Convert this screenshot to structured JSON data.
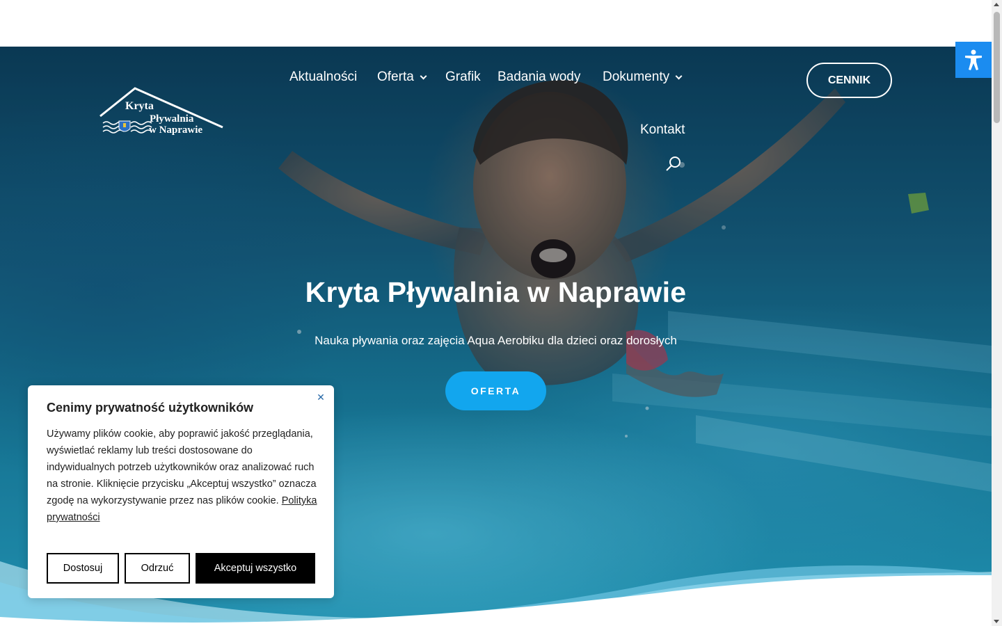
{
  "logo": {
    "line1": "Kryta",
    "line2": "Pływalnia",
    "line3": "w Naprawie"
  },
  "nav": {
    "items": [
      {
        "label": "Aktualności",
        "has_dropdown": false
      },
      {
        "label": "Oferta",
        "has_dropdown": true
      },
      {
        "label": "Grafik",
        "has_dropdown": false
      },
      {
        "label": "Badania wody",
        "has_dropdown": false
      },
      {
        "label": "Dokumenty",
        "has_dropdown": true
      },
      {
        "label": "Kontakt",
        "has_dropdown": false
      }
    ],
    "search_icon": "search-icon"
  },
  "header": {
    "cta_label": "CENNIK"
  },
  "hero": {
    "title": "Kryta Pływalnia w Naprawie",
    "subtitle": "Nauka pływania oraz zajęcia Aqua Aerobiku dla dzieci oraz dorosłych",
    "button_label": "OFERTA"
  },
  "accessibility": {
    "icon": "accessibility-icon"
  },
  "cookie": {
    "title": "Cenimy prywatność użytkowników",
    "text": "Używamy plików cookie, aby poprawić jakość przeglądania, wyświetlać reklamy lub treści dostosowane do indywidualnych potrzeb użytkowników oraz analizować ruch na stronie. Kliknięcie przycisku „Akceptuj wszystko” oznacza zgodę na wykorzystywanie przez nas plików cookie.",
    "link_label": "Polityka prywatności",
    "buttons": {
      "customize": "Dostosuj",
      "reject": "Odrzuć",
      "accept": "Akceptuj wszystko"
    },
    "close_icon": "close-icon"
  },
  "colors": {
    "accent": "#12a6ee",
    "a11y": "#1b8cf0",
    "cookie_primary": "#000000"
  }
}
